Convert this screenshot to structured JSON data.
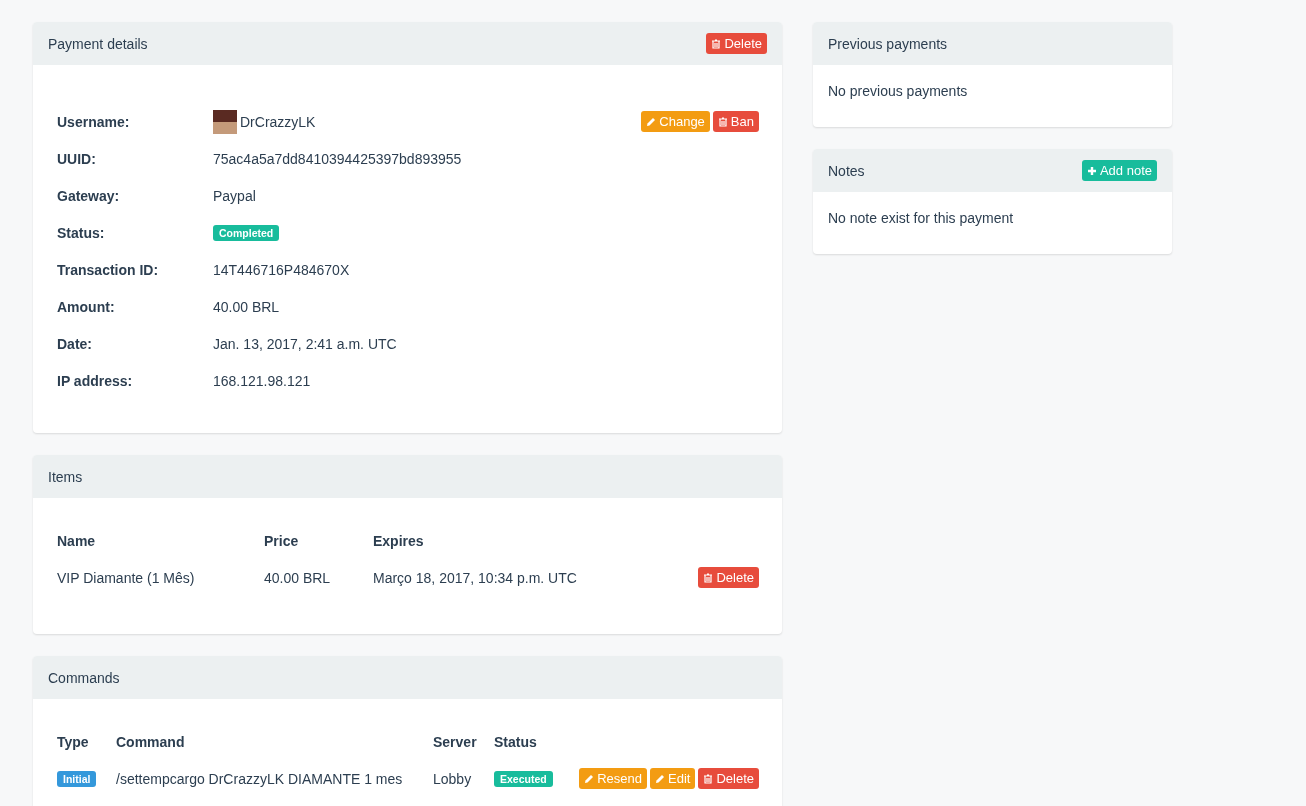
{
  "payment_details": {
    "title": "Payment details",
    "header_button": {
      "label": "Delete",
      "kind": "delete"
    },
    "rows": [
      {
        "kind": "user",
        "label": "Username:",
        "value": "DrCrazzyLK",
        "buttons": [
          {
            "label": "Change",
            "kind": "edit"
          },
          {
            "label": "Ban",
            "kind": "delete"
          }
        ]
      },
      {
        "kind": "text",
        "label": "UUID:",
        "value": "75ac4a5a7dd8410394425397bd893955"
      },
      {
        "kind": "text",
        "label": "Gateway:",
        "value": "Paypal"
      },
      {
        "kind": "badge",
        "label": "Status:",
        "value": "Completed",
        "color": "#18bc9c"
      },
      {
        "kind": "text",
        "label": "Transaction ID:",
        "value": "14T446716P484670X"
      },
      {
        "kind": "text",
        "label": "Amount:",
        "value": "40.00 BRL"
      },
      {
        "kind": "text",
        "label": "Date:",
        "value": "Jan. 13, 2017, 2:41 a.m. UTC"
      },
      {
        "kind": "text",
        "label": "IP address:",
        "value": "168.121.98.121"
      }
    ]
  },
  "items": {
    "title": "Items",
    "columns": [
      "Name",
      "Price",
      "Expires"
    ],
    "rows": [
      {
        "name": "VIP Diamante (1 Mês)",
        "price": "40.00 BRL",
        "expires": "Março 18, 2017, 10:34 p.m. UTC",
        "buttons": [
          {
            "label": "Delete",
            "kind": "delete"
          }
        ]
      }
    ]
  },
  "commands": {
    "title": "Commands",
    "columns": [
      "Type",
      "Command",
      "Server",
      "Status"
    ],
    "rows": [
      {
        "type": {
          "label": "Initial",
          "color": "#3498db"
        },
        "command": "/settempcargo DrCrazzyLK DIAMANTE 1 mes",
        "server": "Lobby",
        "status": {
          "label": "Executed",
          "color": "#18bc9c"
        },
        "buttons": [
          {
            "label": "Resend",
            "kind": "edit"
          },
          {
            "label": "Edit",
            "kind": "edit"
          },
          {
            "label": "Delete",
            "kind": "delete"
          }
        ]
      }
    ]
  },
  "previous_payments": {
    "title": "Previous payments",
    "message": "No previous payments"
  },
  "notes": {
    "title": "Notes",
    "header_button": {
      "label": "Add note",
      "kind": "add"
    },
    "message": "No note exist for this payment"
  }
}
